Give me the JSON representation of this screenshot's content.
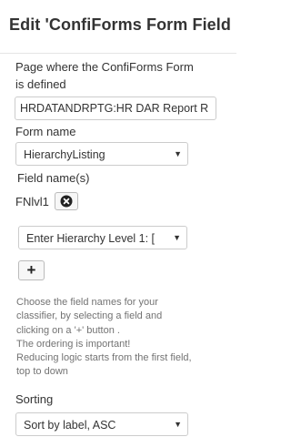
{
  "dialog": {
    "title": "Edit 'ConfiForms Form Field"
  },
  "fields": {
    "page_label_line1": "Page where the ConfiForms Form",
    "page_label_line2": "is defined",
    "page_value": "HRDATANDRPTG:HR DAR Report R",
    "form_name_label": "Form name",
    "form_name_value": "HierarchyListing",
    "field_names_label": "Field name(s)",
    "selected_field": "FNlvl1",
    "field_select_value": "Enter Hierarchy Level 1: [",
    "add_label": "+",
    "help_lines": [
      "Choose the field names for your",
      "classifier, by selecting a field and",
      "clicking on a '+' button .",
      "The ordering is important!",
      "Reducing logic starts from the first field,",
      "top to down"
    ],
    "sorting_label": "Sorting",
    "sorting_value": "Sort by label, ASC"
  },
  "icons": {
    "caret": "chevron-down-icon",
    "remove": "close-circle-icon"
  }
}
